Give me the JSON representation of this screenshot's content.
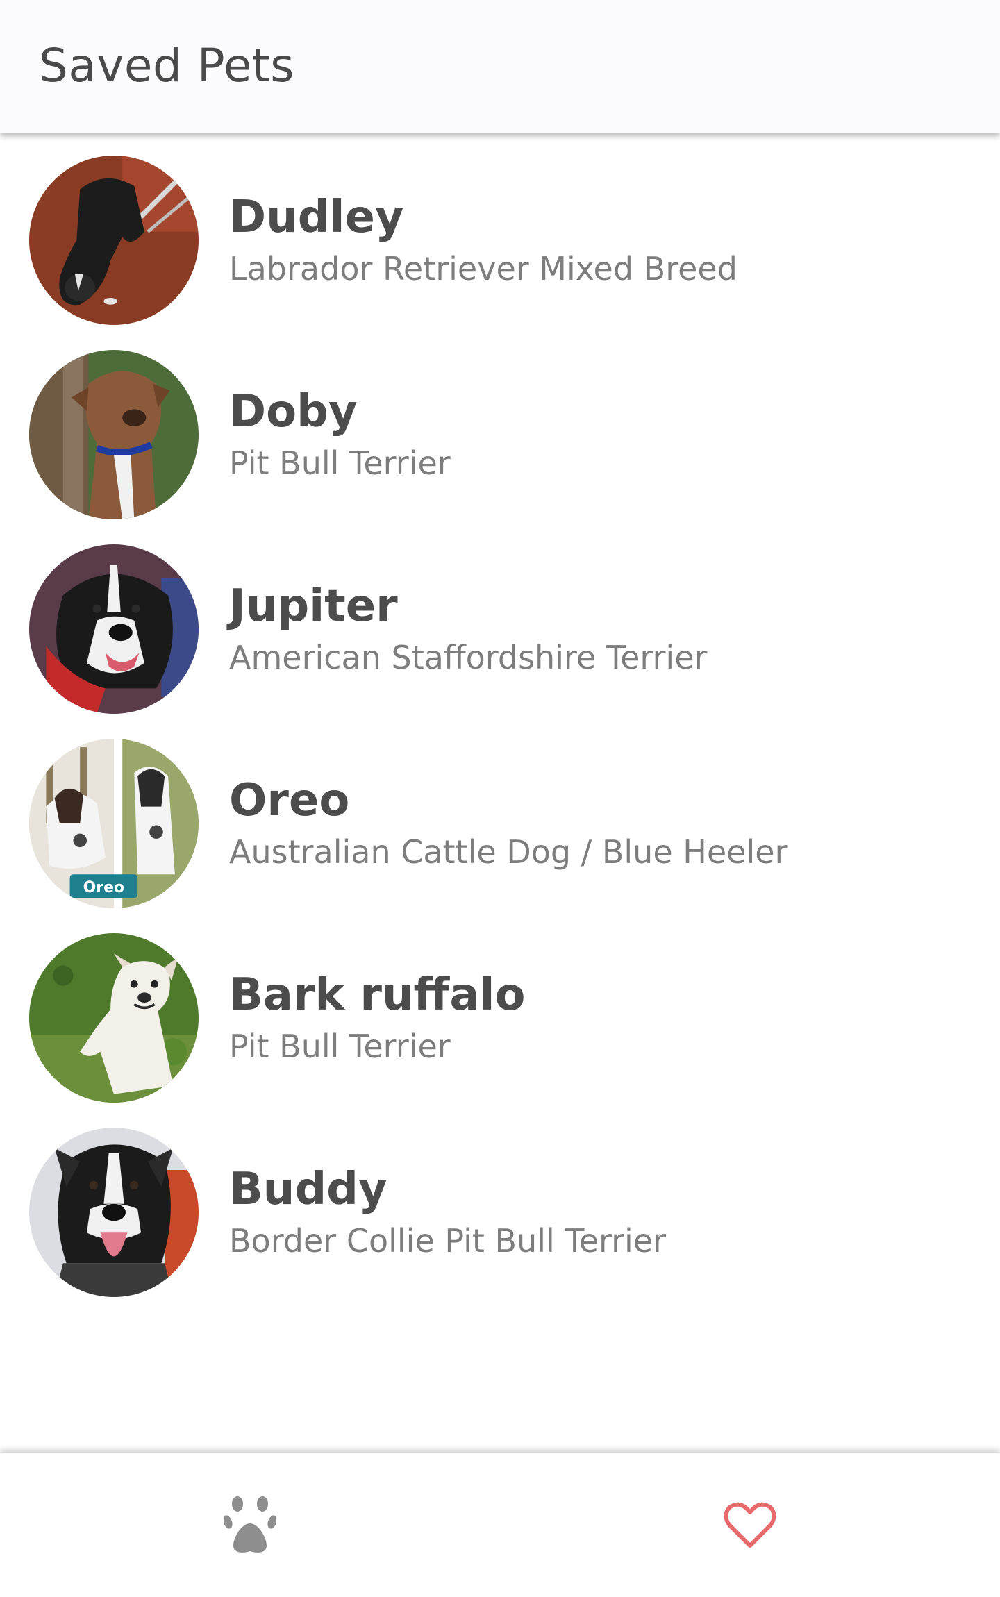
{
  "header": {
    "title": "Saved Pets"
  },
  "pets": [
    {
      "name": "Dudley",
      "breed": "Labrador Retriever Mixed Breed",
      "photo_icon": "dog-photo-black-lab"
    },
    {
      "name": "Doby",
      "breed": "Pit Bull Terrier",
      "photo_icon": "dog-photo-brown-pitbull"
    },
    {
      "name": "Jupiter",
      "breed": "American Staffordshire Terrier",
      "photo_icon": "dog-photo-black-white-staffy"
    },
    {
      "name": "Oreo",
      "breed": "Australian Cattle Dog / Blue Heeler",
      "photo_icon": "dog-photo-heeler",
      "photo_caption": "Oreo"
    },
    {
      "name": "Bark ruffalo",
      "breed": "Pit Bull Terrier",
      "photo_icon": "dog-photo-white-pitbull"
    },
    {
      "name": "Buddy",
      "breed": "Border Collie Pit Bull Terrier",
      "photo_icon": "dog-photo-black-white-pitbull"
    }
  ],
  "tab_bar": {
    "browse_icon": "paw-icon",
    "saved_icon": "heart-icon",
    "active_tab": "saved"
  },
  "colors": {
    "header_bg": "#fbfbfd",
    "title_text": "#4a4a4a",
    "name_text": "#4c4c4c",
    "breed_text": "#7d7d7d",
    "paw_icon": "#8e8e8e",
    "heart_icon": "#e8696b"
  }
}
